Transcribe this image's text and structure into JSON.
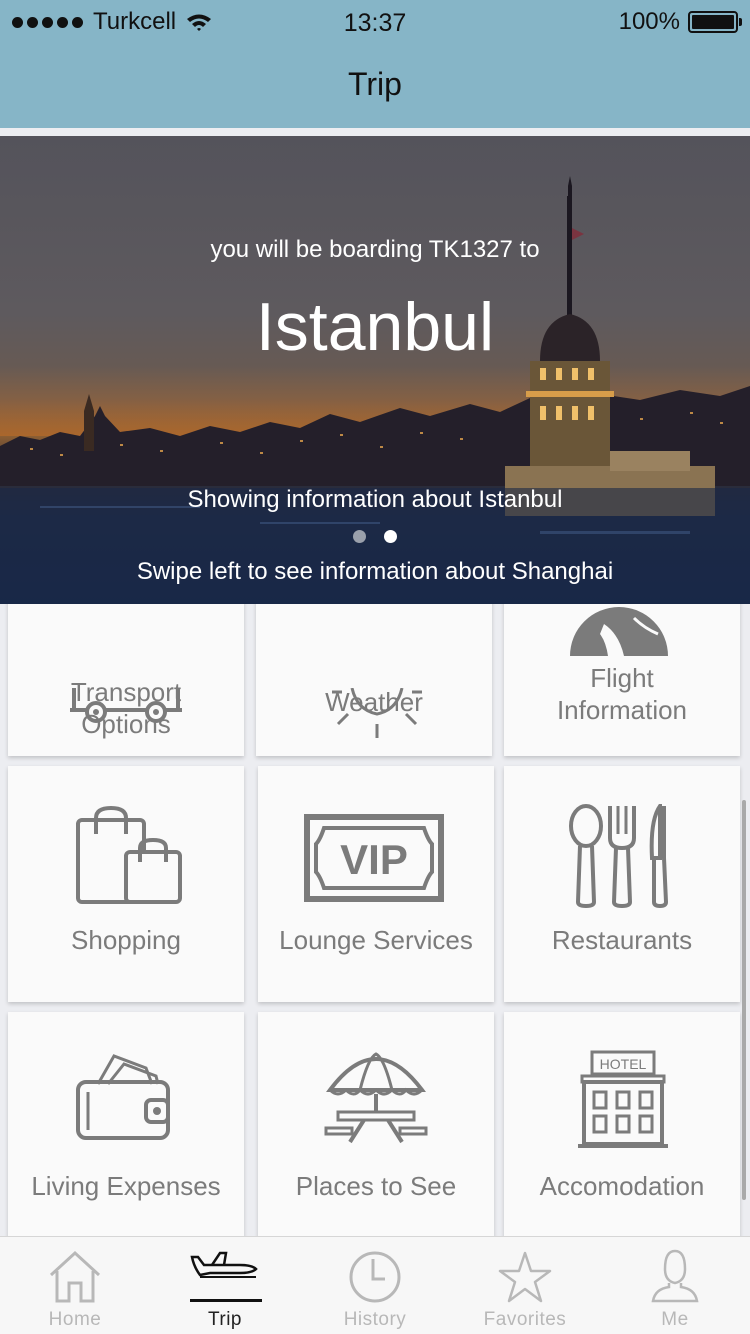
{
  "status_bar": {
    "carrier": "Turkcell",
    "time": "13:37",
    "battery": "100%"
  },
  "nav": {
    "title": "Trip"
  },
  "hero": {
    "boarding_text": "you will be boarding TK1327  to",
    "city": "Istanbul",
    "showing_text": "Showing information about Istanbul",
    "swipe_text": "Swipe left to see information about Shanghai",
    "page_count": 2,
    "current_page": 2
  },
  "tiles": [
    {
      "label": "Transport Options",
      "icon": "bus-icon"
    },
    {
      "label": "Weather",
      "icon": "sun-icon"
    },
    {
      "label": "Flight Information",
      "icon": "globe-icon"
    },
    {
      "label": "Shopping",
      "icon": "shopping-bags-icon"
    },
    {
      "label": "Lounge Services",
      "icon": "vip-icon"
    },
    {
      "label": "Restaurants",
      "icon": "cutlery-icon"
    },
    {
      "label": "Living Expenses",
      "icon": "wallet-icon"
    },
    {
      "label": "Places to See",
      "icon": "picnic-table-icon"
    },
    {
      "label": "Accomodation",
      "icon": "hotel-icon",
      "sign": "HOTEL"
    }
  ],
  "tabs": [
    {
      "label": "Home",
      "icon": "home-icon"
    },
    {
      "label": "Trip",
      "icon": "airplane-icon",
      "active": true
    },
    {
      "label": "History",
      "icon": "clock-icon"
    },
    {
      "label": "Favorites",
      "icon": "star-icon"
    },
    {
      "label": "Me",
      "icon": "person-icon"
    }
  ],
  "colors": {
    "nav_background": "#86b5c7",
    "icon_gray": "#7b7b7b",
    "tab_inactive": "#b8b8b8"
  }
}
